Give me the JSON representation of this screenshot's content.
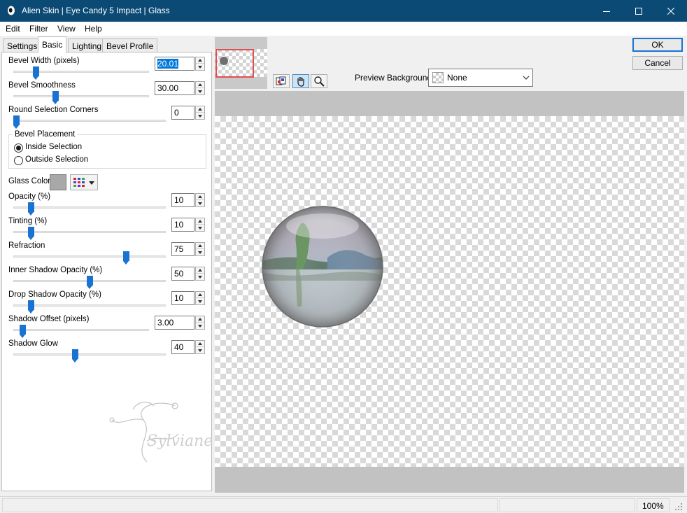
{
  "window": {
    "title": "Alien Skin | Eye Candy 5 Impact | Glass"
  },
  "menu": [
    "Edit",
    "Filter",
    "View",
    "Help"
  ],
  "tabs": [
    "Settings",
    "Basic",
    "Lighting",
    "Bevel Profile"
  ],
  "active_tab": "Basic",
  "controls": {
    "bevel_width": {
      "label": "Bevel Width (pixels)",
      "value": "20.01",
      "level": 0.15
    },
    "bevel_smoothness": {
      "label": "Bevel Smoothness",
      "value": "30.00",
      "level": 0.3
    },
    "round_corners": {
      "label": "Round Selection Corners",
      "value": "0",
      "level": 0.0
    },
    "bevel_placement": {
      "label": "Bevel Placement",
      "options": [
        "Inside Selection",
        "Outside Selection"
      ],
      "selected": "Inside Selection"
    },
    "glass_color": {
      "label": "Glass Color",
      "swatch": "#a8a8a8"
    },
    "opacity": {
      "label": "Opacity (%)",
      "value": "10",
      "level": 0.1
    },
    "tinting": {
      "label": "Tinting (%)",
      "value": "10",
      "level": 0.1
    },
    "refraction": {
      "label": "Refraction",
      "value": "75",
      "level": 0.75
    },
    "inner_shadow_opacity": {
      "label": "Inner Shadow Opacity (%)",
      "value": "50",
      "level": 0.5
    },
    "drop_shadow_opacity": {
      "label": "Drop Shadow Opacity (%)",
      "value": "10",
      "level": 0.1
    },
    "shadow_offset": {
      "label": "Shadow Offset (pixels)",
      "value": "3.00",
      "level": 0.05
    },
    "shadow_glow": {
      "label": "Shadow Glow",
      "value": "40",
      "level": 0.4
    }
  },
  "preview": {
    "background_label": "Preview Background:",
    "background_value": "None"
  },
  "buttons": {
    "ok": "OK",
    "cancel": "Cancel"
  },
  "status": {
    "zoom": "100%"
  },
  "watermark": {
    "text": "Sylviane"
  },
  "colors": {
    "titlebar": "#0b4a75",
    "slider_accent": "#1a73d1",
    "ok_border": "#1a73d1"
  }
}
